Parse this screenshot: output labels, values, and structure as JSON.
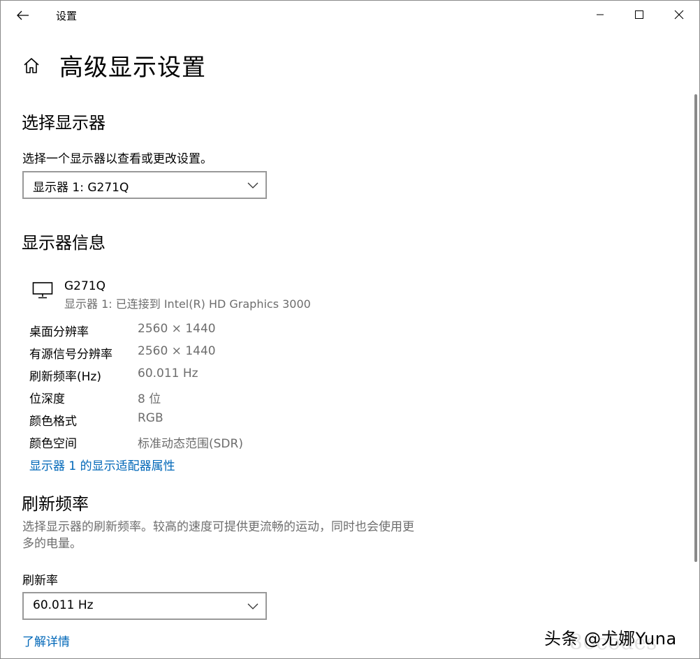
{
  "window": {
    "title": "设置",
    "controls": {
      "minimize": "minimize",
      "maximize": "maximize",
      "close": "close"
    }
  },
  "header": {
    "title": "高级显示设置"
  },
  "select_display": {
    "heading": "选择显示器",
    "prompt": "选择一个显示器以查看或更改设置。",
    "dropdown_value": "显示器 1: G271Q"
  },
  "display_info": {
    "heading": "显示器信息",
    "monitor_name": "G271Q",
    "monitor_subtitle": "显示器 1: 已连接到 Intel(R) HD Graphics 3000",
    "rows": [
      {
        "label": "桌面分辨率",
        "value": "2560 × 1440"
      },
      {
        "label": "有源信号分辨率",
        "value": "2560 × 1440"
      },
      {
        "label": "刷新频率(Hz)",
        "value": "60.011 Hz"
      },
      {
        "label": "位深度",
        "value": "8 位"
      },
      {
        "label": "颜色格式",
        "value": "RGB"
      },
      {
        "label": "颜色空间",
        "value": "标准动态范围(SDR)"
      }
    ],
    "adapter_link": "显示器 1 的显示适配器属性"
  },
  "refresh_rate": {
    "heading": "刷新频率",
    "description": "选择显示器的刷新频率。较高的速度可提供更流畅的运动，同时也会使用更多的电量。",
    "label": "刷新率",
    "dropdown_value": "60.011 Hz",
    "learn_more": "了解详情"
  },
  "watermark": {
    "text": "头条 @尤娜Yuna",
    "ghost_text": "86codes"
  },
  "colors": {
    "link": "#0067b8",
    "muted": "#6d6d6d",
    "dropdown_border": "#999999"
  }
}
